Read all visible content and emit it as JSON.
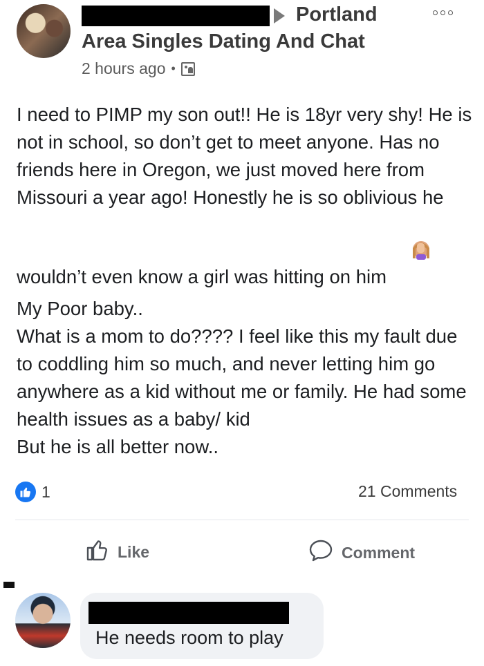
{
  "post": {
    "group_city": "Portland",
    "group_name": "Area Singles Dating And Chat",
    "timestamp": "2 hours ago",
    "separator": "•",
    "body": [
      "I need to PIMP my son out!! He is 18yr very shy! He is not in school, so don’t get to meet anyone. Has no friends here in Oregon, we just moved here from Missouri a year ago! Honestly he is so oblivious he wouldn’t even know a girl was hitting on him",
      "My Poor baby..",
      "What is a mom to do???? I feel like this my fault due to coddling him so much, and never letting him go anywhere as a kid without me or family. He had some  health issues as a baby/ kid",
      "But he is all better now.."
    ],
    "reaction_count": "1",
    "comments_count": "21 Comments"
  },
  "actions": {
    "like_label": "Like",
    "comment_label": "Comment"
  },
  "comment": {
    "text": "He needs room to play"
  },
  "icons": {
    "more": "more-options-icon",
    "privacy": "group-privacy-icon",
    "like": "thumbs-up-icon",
    "comment": "comment-bubble-icon",
    "emoji": "facepalm-woman-emoji"
  },
  "colors": {
    "accent": "#1877f2",
    "text": "#1c1e21",
    "muted": "#65676b",
    "bubble": "#f0f2f5"
  }
}
